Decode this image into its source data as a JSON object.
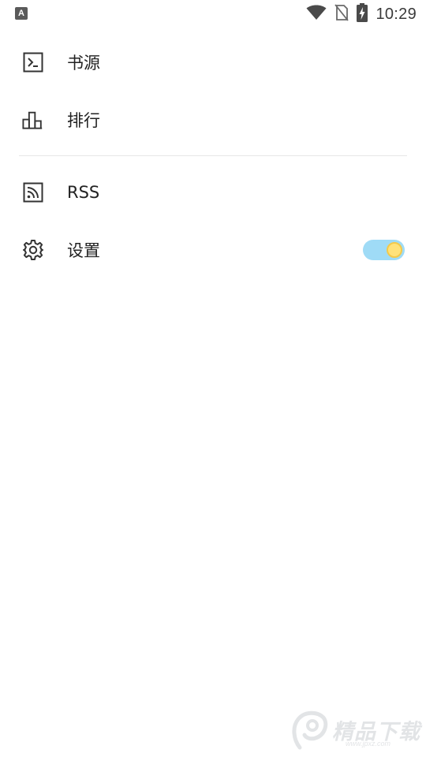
{
  "status_bar": {
    "left_icon": "A",
    "time": "10:29",
    "icons": [
      "wifi-icon",
      "no-sim-icon",
      "battery-charging-icon"
    ]
  },
  "menu": {
    "items": [
      {
        "label": "书源",
        "icon": "terminal-icon"
      },
      {
        "label": "排行",
        "icon": "bar-chart-icon"
      },
      {
        "label": "RSS",
        "icon": "rss-icon"
      },
      {
        "label": "设置",
        "icon": "gear-icon"
      }
    ],
    "settings_toggle": {
      "state": "on",
      "track_color": "#9fdbf6",
      "thumb_color": "#ffe27a"
    }
  },
  "watermark": {
    "text": "精品下载",
    "url": "www.jpxz.com"
  },
  "colors": {
    "background": "#ffffff",
    "text": "#222222",
    "icon": "#333333",
    "divider": "#e6e6e6"
  }
}
